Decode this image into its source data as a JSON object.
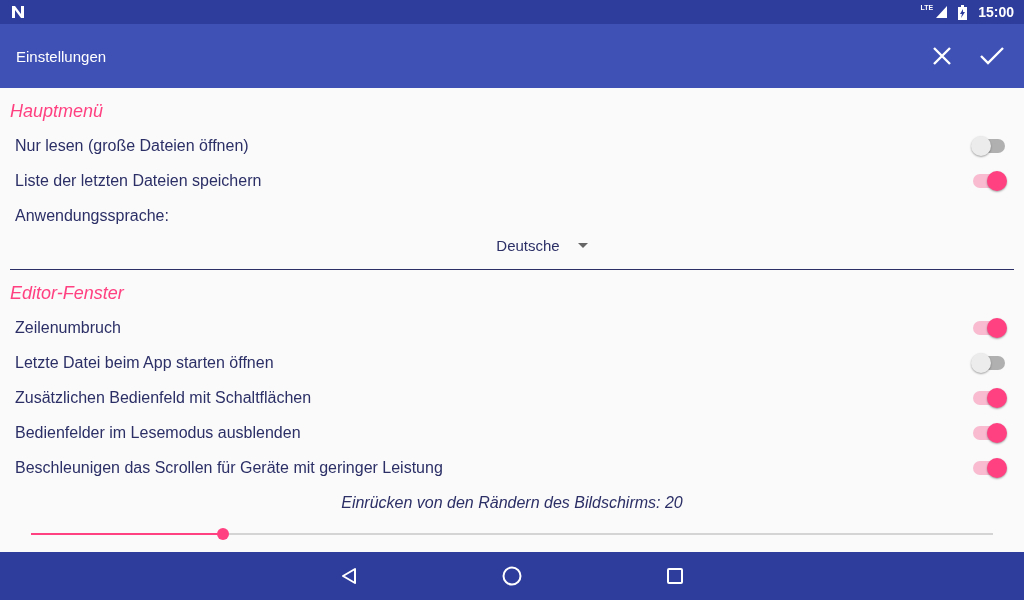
{
  "status_bar": {
    "network": "LTE",
    "time": "15:00"
  },
  "toolbar": {
    "title": "Einstellungen"
  },
  "sections": [
    {
      "title": "Hauptmenü",
      "items": [
        {
          "kind": "switch",
          "label": "Nur lesen (große Dateien öffnen)",
          "on": false
        },
        {
          "kind": "switch",
          "label": "Liste der letzten Dateien speichern",
          "on": true
        },
        {
          "kind": "dropdown",
          "label": "Anwendungssprache:",
          "value": "Deutsche"
        }
      ]
    },
    {
      "title": "Editor-Fenster",
      "items": [
        {
          "kind": "switch",
          "label": "Zeilenumbruch",
          "on": true
        },
        {
          "kind": "switch",
          "label": "Letzte Datei beim App starten öffnen",
          "on": false
        },
        {
          "kind": "switch",
          "label": "Zusätzlichen Bedienfeld mit Schaltflächen",
          "on": true
        },
        {
          "kind": "switch",
          "label": "Bedienfelder im Lesemodus ausblenden",
          "on": true
        },
        {
          "kind": "switch",
          "label": "Beschleunigen das Scrollen für Geräte mit geringer Leistung",
          "on": true
        },
        {
          "kind": "slider",
          "label": "Einrücken von den Rändern des Bildschirms: 20",
          "level": 0.2
        }
      ]
    }
  ]
}
